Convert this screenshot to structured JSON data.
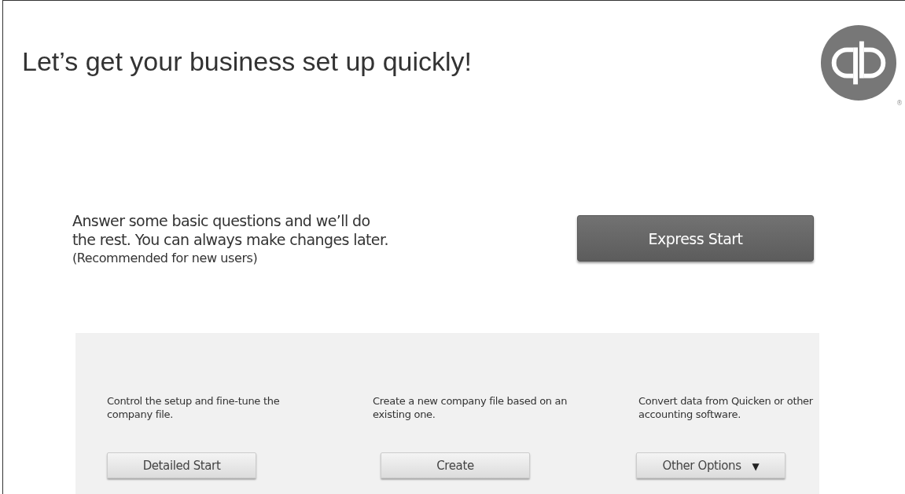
{
  "title": "Let’s get your business set up quickly!",
  "registered_mark": "®",
  "express": {
    "description": "Answer some basic questions and we’ll do the rest. You can always make changes later.",
    "note": "(Recommended for new users)",
    "button": "Express Start"
  },
  "options": [
    {
      "description": "Control the setup and fine-tune the company file.",
      "button": "Detailed Start",
      "kind": "plain"
    },
    {
      "description": "Create a new company file based on an existing one.",
      "button": "Create",
      "kind": "plain"
    },
    {
      "description": "Convert data from Quicken or other accounting software.",
      "button": "Other Options",
      "kind": "dropdown",
      "caret": "▼"
    }
  ]
}
